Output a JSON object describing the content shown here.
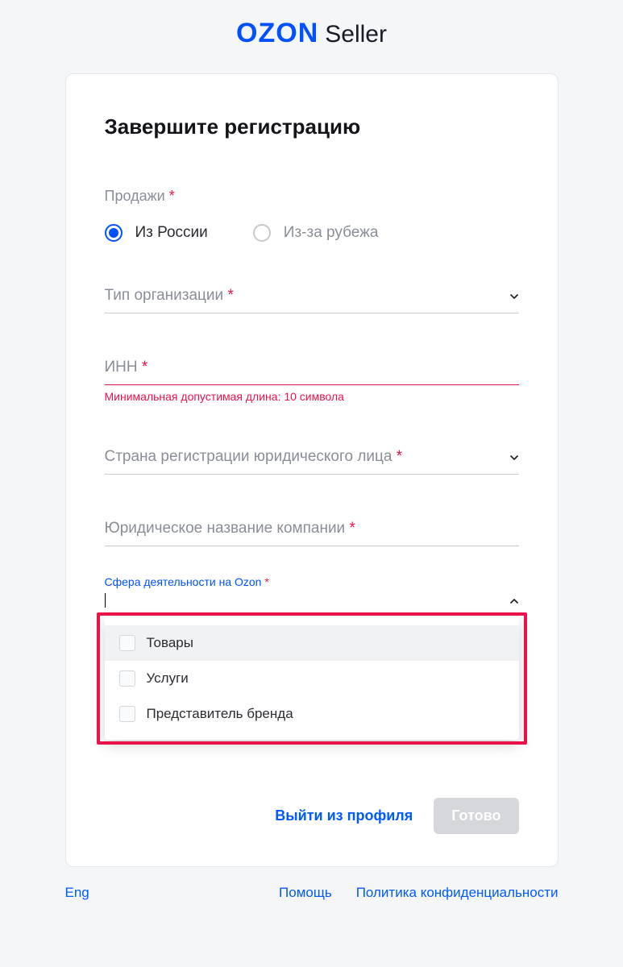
{
  "logo": {
    "brand": "OZON",
    "suffix": "Seller"
  },
  "card": {
    "title": "Завершите регистрацию",
    "salesLabel": "Продажи",
    "asterisk": "*",
    "radios": {
      "russia": "Из России",
      "abroad": "Из-за рубежа"
    },
    "orgType": {
      "label": "Тип организации"
    },
    "inn": {
      "label": "ИНН",
      "error": "Минимальная допустимая длина: 10 символа"
    },
    "country": {
      "label": "Страна регистрации юридического лица"
    },
    "company": {
      "label": "Юридическое название компании"
    },
    "activity": {
      "label": "Сфера деятельности на Ozon",
      "options": [
        "Товары",
        "Услуги",
        "Представитель бренда"
      ]
    },
    "actions": {
      "logout": "Выйти из профиля",
      "submit": "Готово"
    }
  },
  "footer": {
    "lang": "Eng",
    "help": "Помощь",
    "privacy": "Политика конфиденциальности"
  }
}
